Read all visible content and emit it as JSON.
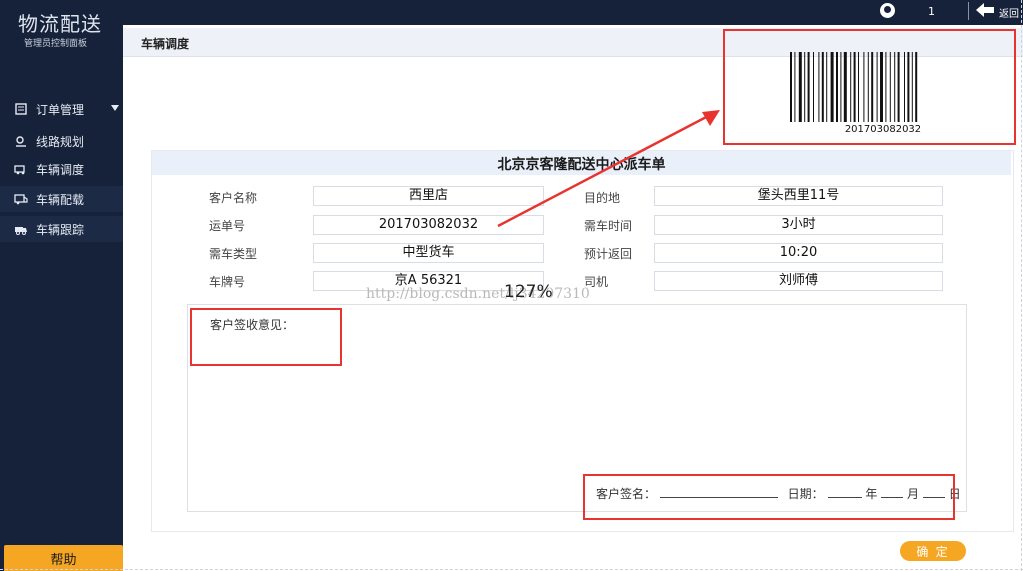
{
  "app": {
    "brand": "物流配送",
    "brand_sub": "管理员控制面板",
    "help_label": "帮助"
  },
  "sidebar": {
    "items": [
      {
        "label": "订单管理",
        "icon": "order-icon"
      },
      {
        "label": "线路规划",
        "icon": "route-icon"
      },
      {
        "label": "车辆调度",
        "icon": "vehicle-dispatch-icon"
      },
      {
        "label": "车辆配载",
        "icon": "vehicle-load-icon"
      },
      {
        "label": "车辆跟踪",
        "icon": "vehicle-track-icon"
      }
    ]
  },
  "topbar": {
    "user_count": "1",
    "back_label": "返回"
  },
  "page": {
    "title": "车辆调度"
  },
  "barcode": {
    "number": "201703082032"
  },
  "form": {
    "title": "北京京客隆配送中心派车单",
    "fields": {
      "customer_name_label": "客户名称",
      "customer_name_value": "西里店",
      "destination_label": "目的地",
      "destination_value": "堡头西里11号",
      "waybill_label": "运单号",
      "waybill_value": "201703082032",
      "hours_label": "需车时间",
      "hours_value": "3小时",
      "vehicle_type_label": "需车类型",
      "vehicle_type_value": "中型货车",
      "return_label": "预计返回",
      "return_value": "10:20",
      "plate_label": "车牌号",
      "plate_value": "京A 56321",
      "driver_label": "司机",
      "driver_value": "刘师傅"
    },
    "remarks_label": "客户签收意见：",
    "sign_label": "客户签名：",
    "date_label": "日期：",
    "year_label": "年",
    "month_label": "月",
    "day_label": "日"
  },
  "confirm_label": "确 定",
  "overlay": {
    "watermark": "http://blog.csdn.net/lj34207310",
    "zoom": "127%"
  },
  "colors": {
    "sidebar_bg": "#16213a",
    "accent": "#f5a623",
    "annotation_red": "#e8342f"
  }
}
